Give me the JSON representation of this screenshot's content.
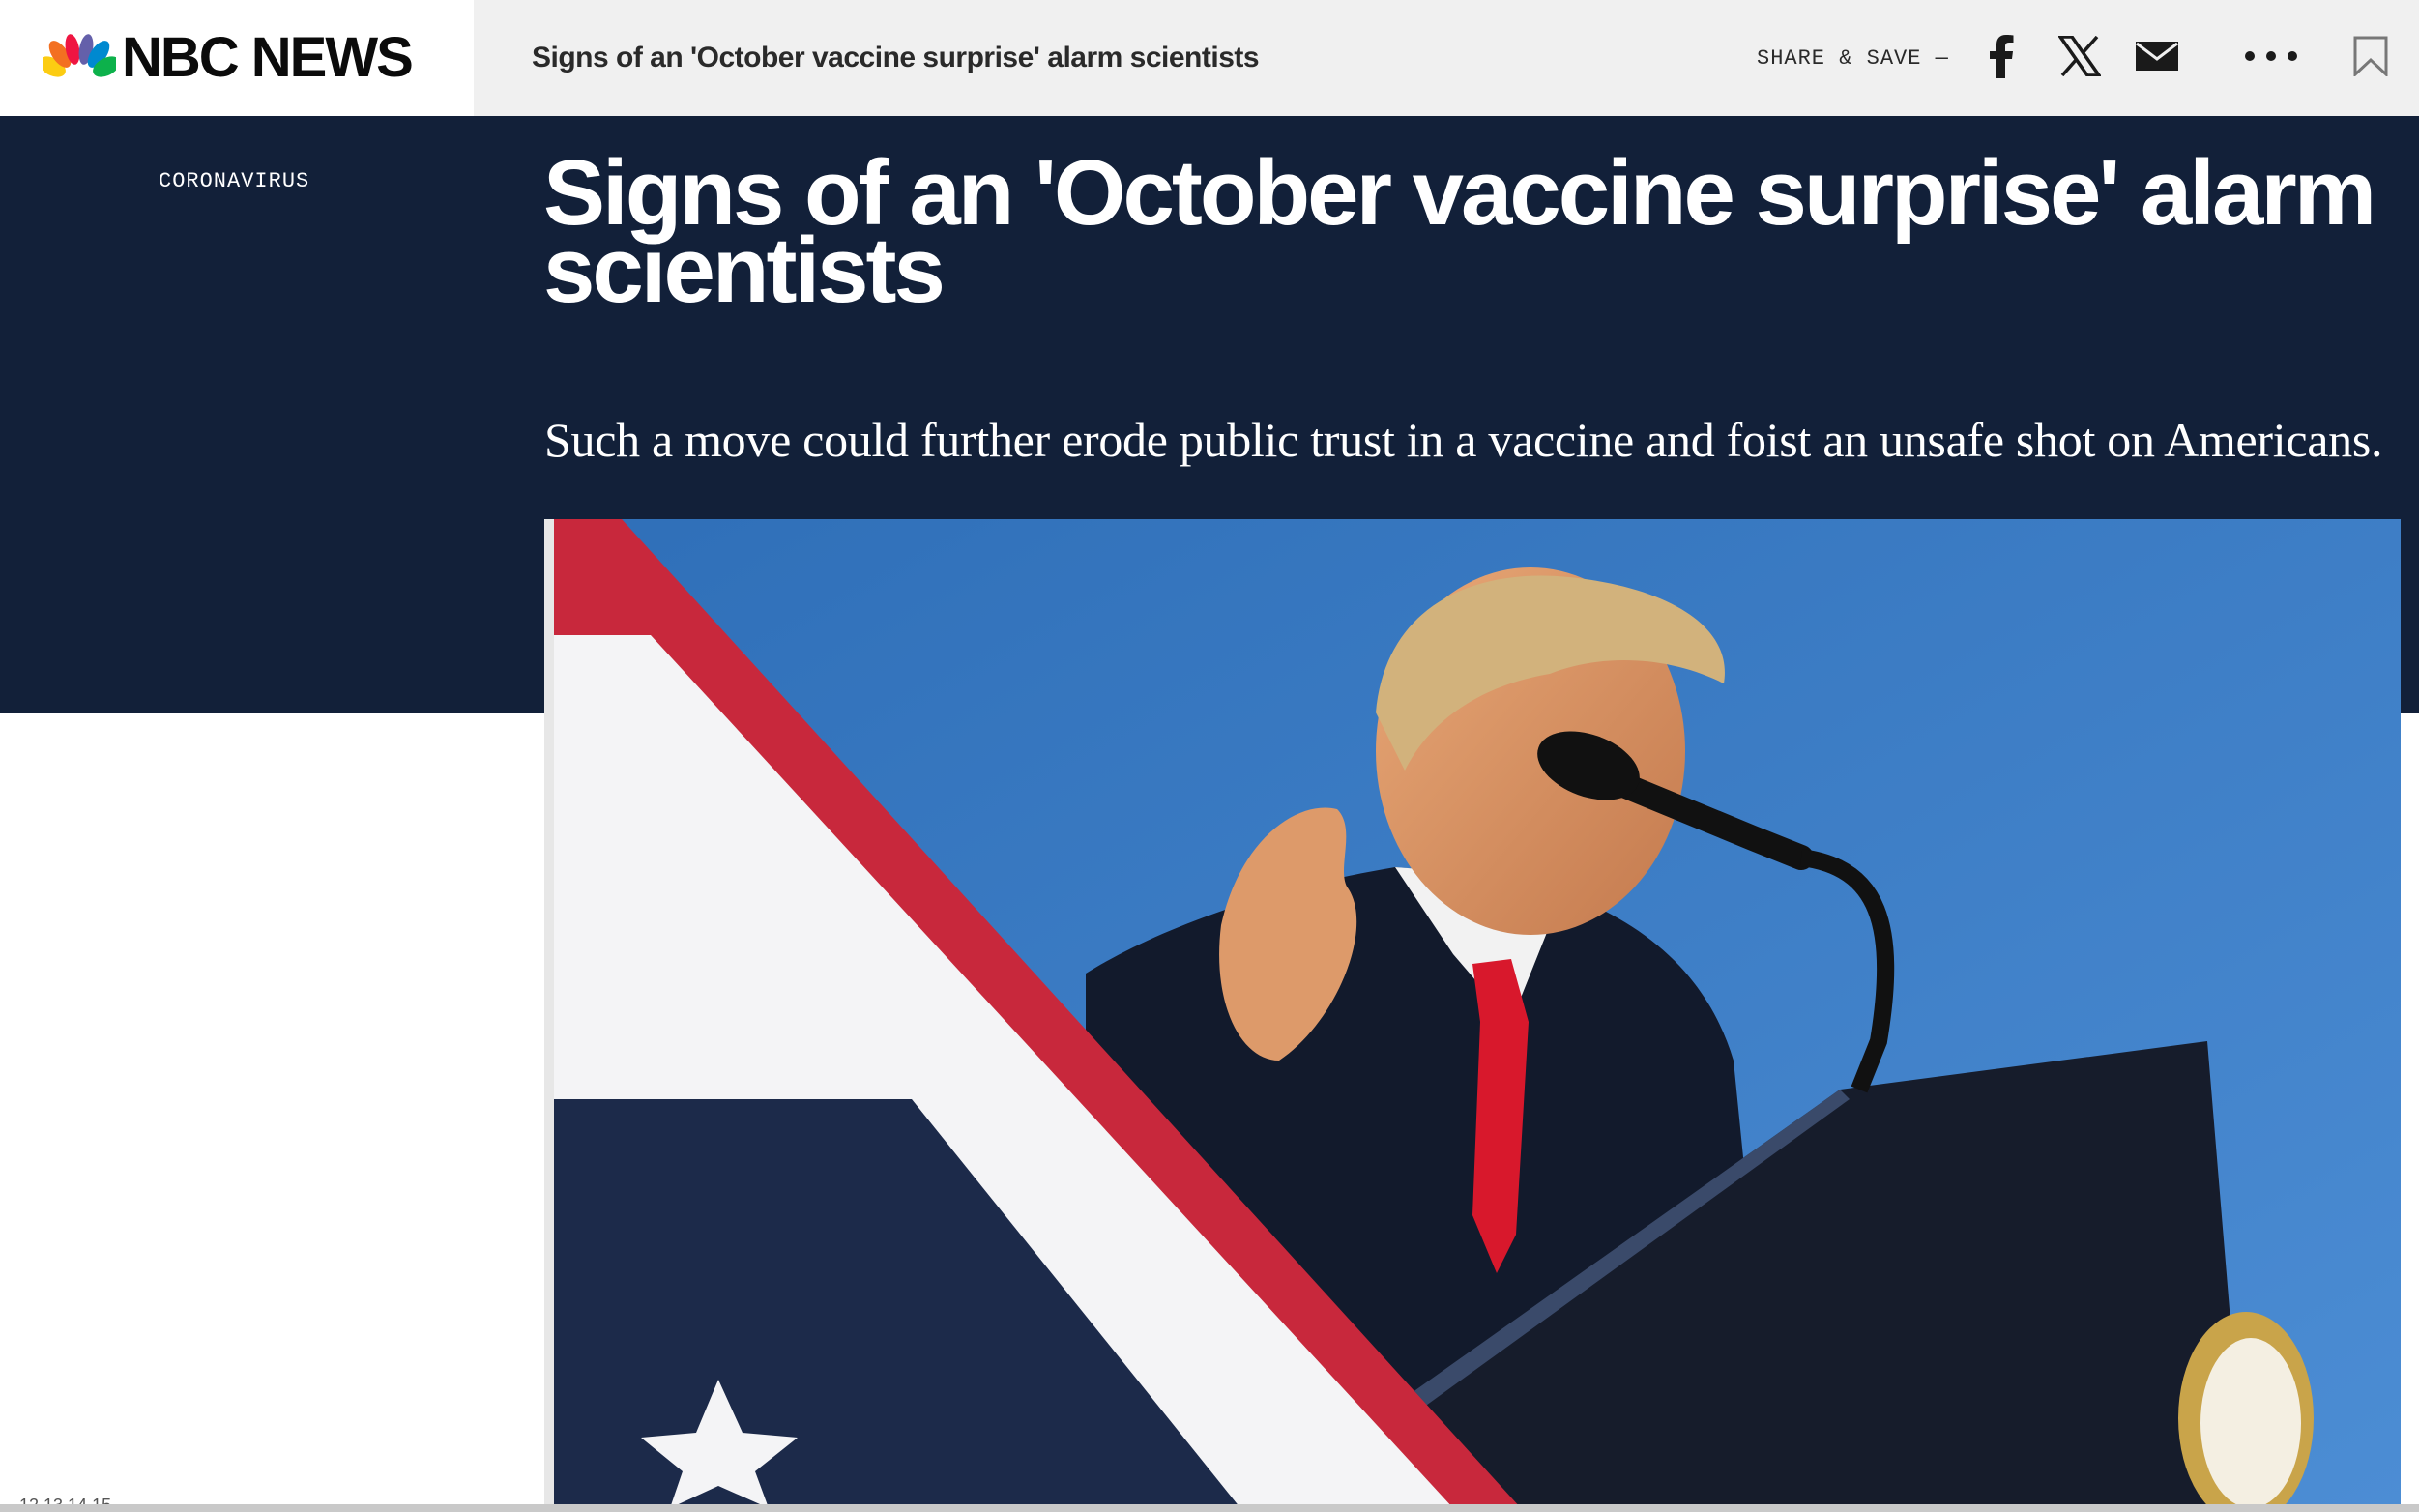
{
  "brand": {
    "name": "NBC NEWS",
    "logo_colors": [
      "#fccc12",
      "#ef1541",
      "#6460aa",
      "#0089d0",
      "#0db14b",
      "#f37021"
    ]
  },
  "topbar": {
    "article_title": "Signs of an 'October vaccine surprise' alarm scientists",
    "share_label": "SHARE & SAVE —",
    "share_icons": [
      "facebook-icon",
      "x-icon",
      "email-icon",
      "more-icon",
      "bookmark-icon"
    ]
  },
  "article": {
    "section": "CORONAVIRUS",
    "headline": "Signs of an 'October vaccine surprise' alarm scientists",
    "dek": "Such a move could further erode public trust in a vaccine and foist an unsafe shot on Americans."
  },
  "footer_ruler": "12   13   14   15",
  "colors": {
    "hero_background": "#122039",
    "topbar_background": "#f0f0f0",
    "text_on_dark": "#ffffff",
    "sky": "#3f7fc4"
  }
}
